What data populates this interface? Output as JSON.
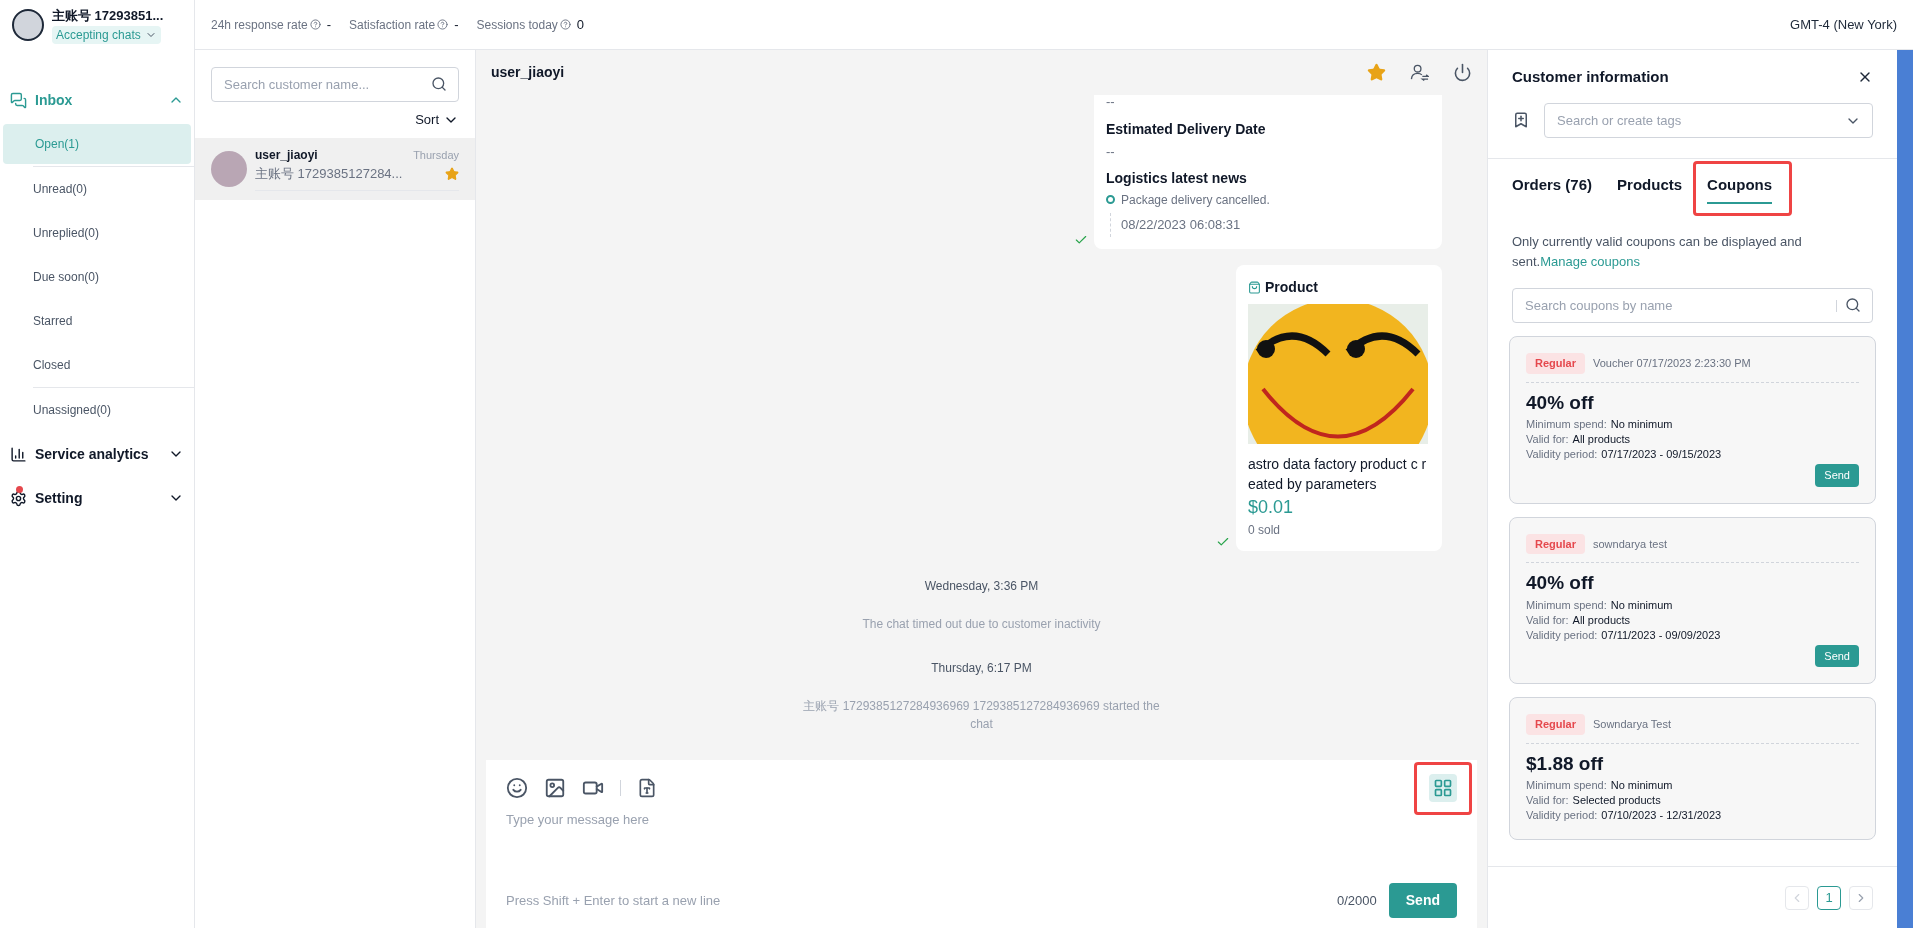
{
  "account": {
    "name": "主账号 17293851...",
    "status": "Accepting chats"
  },
  "sidebar": {
    "sections": [
      {
        "kind": "inbox",
        "label": "Inbox",
        "expanded": true,
        "groups": [
          [
            {
              "label": "Open(1)",
              "selected": true
            }
          ],
          [
            {
              "label": "Unread(0)",
              "selected": false
            },
            {
              "label": "Unreplied(0)",
              "selected": false
            },
            {
              "label": "Due soon(0)",
              "selected": false
            },
            {
              "label": "Starred",
              "selected": false
            },
            {
              "label": "Closed",
              "selected": false
            }
          ],
          [
            {
              "label": "Unassigned(0)",
              "selected": false
            }
          ]
        ]
      },
      {
        "kind": "analytics",
        "label": "Service analytics",
        "expanded": false
      },
      {
        "kind": "setting",
        "label": "Setting",
        "expanded": false,
        "badge": true
      }
    ]
  },
  "metrics": [
    {
      "label": "24h response rate",
      "value": "-"
    },
    {
      "label": "Satisfaction rate",
      "value": "-"
    },
    {
      "label": "Sessions today",
      "value": "0"
    }
  ],
  "timezone": "GMT-4 (New York)",
  "conversation_list": {
    "search_placeholder": "Search customer name...",
    "sort": "Sort",
    "items": [
      {
        "name": "user_jiaoyi",
        "time": "Thursday",
        "preview": "主账号 1729385127284...",
        "starred": true,
        "selected": true
      }
    ]
  },
  "chat": {
    "title": "user_jiaoyi",
    "starred": true,
    "messages": [
      {
        "kind": "logistics",
        "read": true,
        "top_value": "--",
        "delivery_label": "Estimated Delivery Date",
        "delivery_value": "--",
        "news_label": "Logistics latest news",
        "event": "Package delivery cancelled.",
        "event_time": "08/22/2023 06:08:31"
      },
      {
        "kind": "product",
        "read": true,
        "title": "Product",
        "name": "astro data factory product c reated by parameters",
        "price": "$0.01",
        "sold": "0 sold"
      },
      {
        "kind": "time",
        "text": "Wednesday, 3:36 PM"
      },
      {
        "kind": "notice",
        "text": "The chat timed out due to customer inactivity"
      },
      {
        "kind": "time",
        "text": "Thursday, 6:17 PM"
      },
      {
        "kind": "notice",
        "text": "主账号 1729385127284936969 1729385127284936969 started the chat"
      }
    ],
    "composer": {
      "placeholder": "Type your message here",
      "hint": "Press Shift + Enter to start a new line",
      "counter": "0/2000",
      "send": "Send",
      "apps_active": true
    }
  },
  "customer_panel": {
    "title": "Customer information",
    "tag_placeholder": "Search or create tags",
    "tabs": [
      {
        "label": "Orders (76)",
        "selected": false
      },
      {
        "label": "Products",
        "selected": false
      },
      {
        "label": "Coupons",
        "selected": true
      }
    ],
    "note": "Only currently valid coupons can be displayed and sent.",
    "note_link": "Manage coupons",
    "coupon_search_placeholder": "Search coupons by name",
    "coupons": [
      {
        "tag": "Regular",
        "name": "Voucher 07/17/2023 2:23:30 PM",
        "discount": "40% off",
        "min_label": "Minimum spend:",
        "min": "No minimum",
        "valid_label": "Valid for:",
        "valid": "All products",
        "period_label": "Validity period:",
        "period": "07/17/2023 - 09/15/2023",
        "send": "Send"
      },
      {
        "tag": "Regular",
        "name": "sowndarya test",
        "discount": "40% off",
        "min_label": "Minimum spend:",
        "min": "No minimum",
        "valid_label": "Valid for:",
        "valid": "All products",
        "period_label": "Validity period:",
        "period": "07/11/2023 - 09/09/2023",
        "send": "Send"
      },
      {
        "tag": "Regular",
        "name": "Sowndarya Test",
        "discount": "$1.88 off",
        "min_label": "Minimum spend:",
        "min": "No minimum",
        "valid_label": "Valid for:",
        "valid": "Selected products",
        "period_label": "Validity period:",
        "period": "07/10/2023 - 12/31/2023"
      }
    ],
    "page": "1"
  }
}
